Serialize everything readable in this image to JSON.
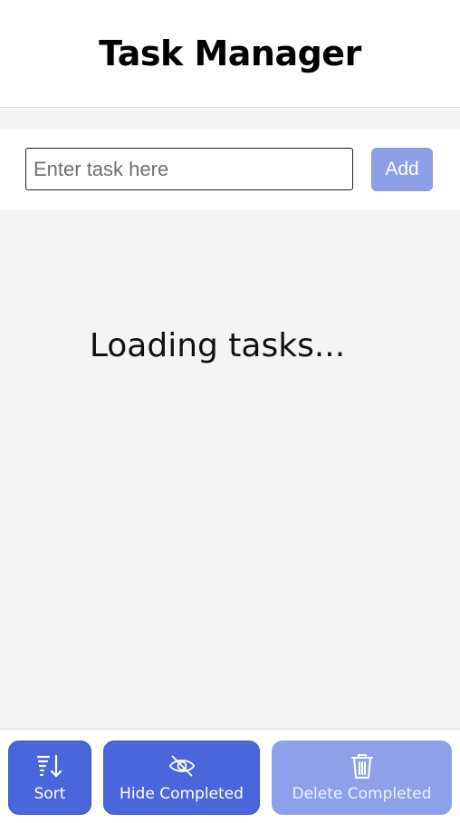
{
  "header": {
    "title": "Task Manager"
  },
  "task_input": {
    "placeholder": "Enter task here",
    "value": ""
  },
  "add_button": {
    "label": "Add"
  },
  "content": {
    "status_text": "Loading tasks..."
  },
  "footer": {
    "sort": {
      "label": "Sort",
      "icon": "sort-icon"
    },
    "hide_completed": {
      "label": "Hide Completed",
      "icon": "eye-off-icon"
    },
    "delete_completed": {
      "label": "Delete Completed",
      "icon": "trash-icon",
      "disabled": true
    }
  },
  "colors": {
    "primary": "#4b65da",
    "primary_disabled": "#8ea1e8",
    "background": "#f4f4f4",
    "surface": "#ffffff"
  }
}
